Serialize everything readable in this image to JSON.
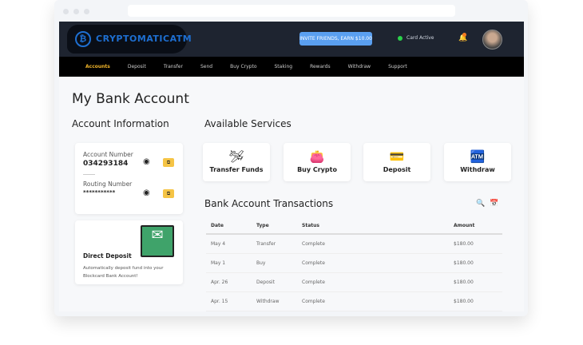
{
  "header": {
    "logo_text": "CRYPTOMATICATM",
    "invite_label": "INVITE FRIENDS, EARN $10.00",
    "card_status": "Card Active"
  },
  "nav": [
    "Accounts",
    "Deposit",
    "Transfer",
    "Send",
    "Buy Crypto",
    "Staking",
    "Rewards",
    "Withdraw",
    "Support"
  ],
  "page_title": "My Bank Account",
  "account_info": {
    "heading": "Account Information",
    "account_label": "Account Number",
    "account_value": "034293184",
    "routing_label": "Routing Number",
    "routing_value": "***********"
  },
  "direct_deposit": {
    "title": "Direct Deposit",
    "desc": "Automatically deposit fund into your Blockcard Bank Account!"
  },
  "services": {
    "heading": "Available Services",
    "items": [
      "Transfer Funds",
      "Buy Crypto",
      "Deposit",
      "Withdraw"
    ]
  },
  "transactions": {
    "heading": "Bank Account Transactions",
    "columns": [
      "Date",
      "Type",
      "Status",
      "Amount"
    ],
    "rows": [
      [
        "May 4",
        "Transfer",
        "Complete",
        "$180.00"
      ],
      [
        "May 1",
        "Buy",
        "Complete",
        "$180.00"
      ],
      [
        "Apr. 26",
        "Deposit",
        "Complete",
        "$180.00"
      ],
      [
        "Apr. 15",
        "Withdraw",
        "Complete",
        "$180.00"
      ]
    ]
  }
}
